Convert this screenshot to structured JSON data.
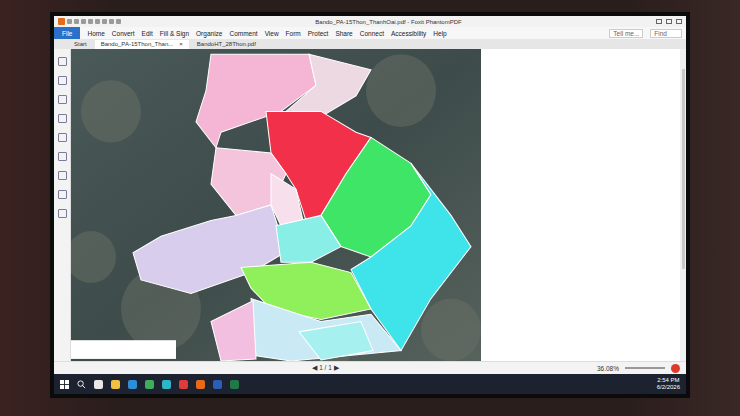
{
  "window": {
    "title": "Bando_PA-15Thon_ThanhOai.pdf - Foxit PhantomPDF"
  },
  "ribbon": {
    "file": "File",
    "tabs": [
      {
        "label": "Home",
        "selected": false
      },
      {
        "label": "Convert",
        "selected": false
      },
      {
        "label": "Edit",
        "selected": false
      },
      {
        "label": "Fill & Sign",
        "selected": false
      },
      {
        "label": "Organize",
        "selected": false
      },
      {
        "label": "Comment",
        "selected": false
      },
      {
        "label": "View",
        "selected": false
      },
      {
        "label": "Form",
        "selected": false
      },
      {
        "label": "Protect",
        "selected": false
      },
      {
        "label": "Share",
        "selected": false
      },
      {
        "label": "Connect",
        "selected": false
      },
      {
        "label": "Accessibility",
        "selected": false
      },
      {
        "label": "Help",
        "selected": false
      }
    ],
    "tell_me": "Tell me...",
    "find": "Find"
  },
  "doc_tabs": [
    {
      "label": "Start",
      "selected": false,
      "close": ""
    },
    {
      "label": "Bando_PA-15Thon_Than...",
      "selected": true,
      "close": "×"
    },
    {
      "label": "BandoHT_28Thon.pdf",
      "selected": false,
      "close": ""
    }
  ],
  "map": {
    "regions": [
      {
        "color": "#f5b5d5"
      },
      {
        "color": "#ecd9e2"
      },
      {
        "color": "#f2304a"
      },
      {
        "color": "#f4c4dc"
      },
      {
        "color": "#d9cdee"
      },
      {
        "color": "#f7e0ec"
      },
      {
        "color": "#3fe567"
      },
      {
        "color": "#3fe3ea"
      },
      {
        "color": "#88eee6"
      },
      {
        "color": "#8ff05c"
      },
      {
        "color": "#c9e9f5"
      },
      {
        "color": "#f3bfe0"
      },
      {
        "color": "#a6f0f0"
      }
    ]
  },
  "status": {
    "page": "1 / 1",
    "zoom": "36.08%"
  },
  "taskbar": {
    "time": "2:54 PM",
    "date": "6/2/2026"
  }
}
